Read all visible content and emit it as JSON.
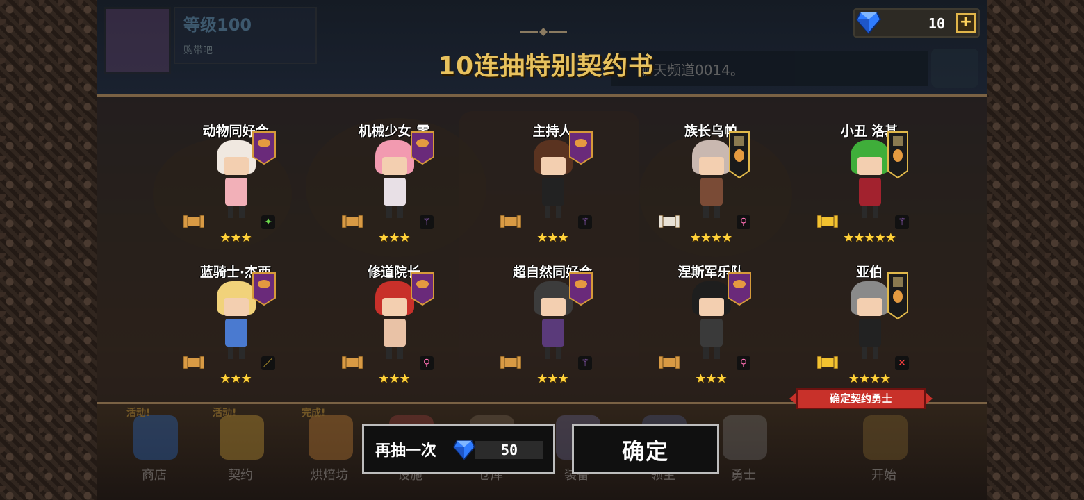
{
  "header": {
    "title": "10连抽特别契约书",
    "profile": {
      "level": "等级100",
      "subtitle": "购带吧"
    },
    "chat_text": "聊天频道0014。",
    "currency": {
      "amount": "10",
      "plus": "+"
    }
  },
  "heroes": [
    {
      "name": "动物同好会",
      "stars": "★★★",
      "hair": "#f0e8e0",
      "body": "#f2b0b8",
      "badge": "banner",
      "scroll": "gold",
      "elem": "leaf",
      "elem_color": "#6ddb4d"
    },
    {
      "name": "机械少女-零",
      "stars": "★★★",
      "hair": "#f29ab0",
      "body": "#e8e0e6",
      "badge": "banner",
      "scroll": "gold",
      "elem": "wand",
      "elem_color": "#c47bff"
    },
    {
      "name": "主持人",
      "stars": "★★★",
      "hair": "#5a3320",
      "body": "#222222",
      "badge": "banner",
      "scroll": "gold",
      "elem": "wand",
      "elem_color": "#c47bff"
    },
    {
      "name": "族长乌帕",
      "stars": "★★★★",
      "hair": "#c9b8b0",
      "body": "#7a4b36",
      "badge": "flag",
      "scroll": "white",
      "elem": "potion",
      "elem_color": "#ff6fb4"
    },
    {
      "name": "小丑 洛基",
      "stars": "★★★★★",
      "hair": "#3fae3a",
      "body": "#a2222e",
      "badge": "flag",
      "scroll": "yellow",
      "elem": "wand",
      "elem_color": "#c47bff"
    },
    {
      "name": "蓝骑士·杰西",
      "stars": "★★★",
      "hair": "#f1d27a",
      "body": "#4a7ad0",
      "badge": "banner",
      "scroll": "gold",
      "elem": "sword",
      "elem_color": "#ffd23a"
    },
    {
      "name": "修道院长",
      "stars": "★★★",
      "hair": "#c8302a",
      "body": "#e9c2a6",
      "badge": "banner",
      "scroll": "gold",
      "elem": "potion",
      "elem_color": "#ff6fb4"
    },
    {
      "name": "超自然同好会",
      "stars": "★★★",
      "hair": "#3c3c3c",
      "body": "#5a3a7a",
      "badge": "banner",
      "scroll": "gold",
      "elem": "wand",
      "elem_color": "#c47bff"
    },
    {
      "name": "涅斯军乐队",
      "stars": "★★★",
      "hair": "#1e1e1e",
      "body": "#3a3a3a",
      "badge": "banner",
      "scroll": "gold",
      "elem": "potion",
      "elem_color": "#ff6fb4"
    },
    {
      "name": "亚伯",
      "stars": "★★★★",
      "hair": "#8a8a8a",
      "body": "#222222",
      "badge": "flag",
      "scroll": "yellow",
      "elem": "cross",
      "elem_color": "#ff4040"
    }
  ],
  "confirm_tag": "确定契约勇士",
  "nav": [
    {
      "label": "商店",
      "tag": "活动!",
      "color": "#2a6fd0"
    },
    {
      "label": "契约",
      "tag": "活动!",
      "color": "#d6a63a"
    },
    {
      "label": "烘焙坊",
      "tag": "完成!",
      "color": "#d48a3a"
    },
    {
      "label": "设施",
      "tag": "",
      "color": "#a04040"
    },
    {
      "label": "仓库",
      "tag": "",
      "color": "#7a6a5a"
    },
    {
      "label": "装备",
      "tag": "",
      "color": "#6a6a9a"
    },
    {
      "label": "领主",
      "tag": "",
      "color": "#4a5a8a"
    },
    {
      "label": "勇士",
      "tag": "",
      "color": "#777777"
    },
    {
      "label": "开始",
      "tag": "",
      "color": "#8a6a30"
    }
  ],
  "buttons": {
    "redraw_label": "再抽一次",
    "redraw_cost": "50",
    "confirm_label": "确定"
  },
  "colors": {
    "gold": "#e8c25e",
    "gem": "#2f7cff",
    "tag_red": "#c8312a"
  }
}
